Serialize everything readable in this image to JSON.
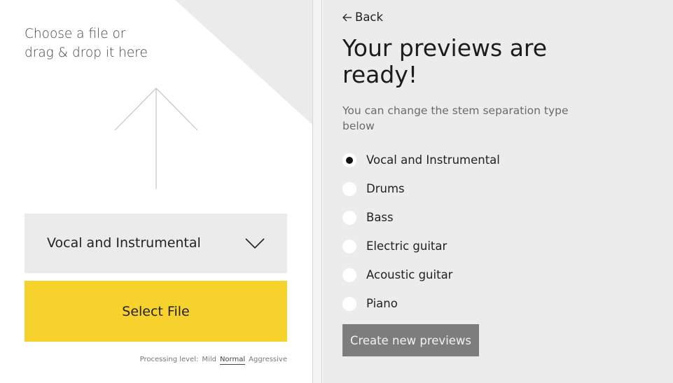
{
  "upload": {
    "prompt_line1": "Choose a file or",
    "prompt_line2": "drag & drop it here",
    "icon": "upload-arrow-icon"
  },
  "separation_dropdown": {
    "value": "Vocal and Instrumental",
    "icon": "chevron-down-icon"
  },
  "select_file_button": {
    "label": "Select File"
  },
  "processing_level": {
    "label": "Processing level:",
    "options": [
      "Mild",
      "Normal",
      "Aggressive"
    ],
    "selected": "Normal"
  },
  "previews": {
    "back_label": "Back",
    "back_icon": "arrow-left-icon",
    "title": "Your previews are ready!",
    "subtitle": "You can change the stem separation type below",
    "stem_options": [
      {
        "label": "Vocal and Instrumental",
        "selected": true
      },
      {
        "label": "Drums",
        "selected": false
      },
      {
        "label": "Bass",
        "selected": false
      },
      {
        "label": "Electric guitar",
        "selected": false
      },
      {
        "label": "Acoustic guitar",
        "selected": false
      },
      {
        "label": "Piano",
        "selected": false
      }
    ],
    "create_button_label": "Create new previews"
  },
  "colors": {
    "accent_yellow": "#f7d22c",
    "panel_gray": "#ececec",
    "dropdown_gray": "#ebebeb",
    "button_gray": "#7d7d7d"
  }
}
